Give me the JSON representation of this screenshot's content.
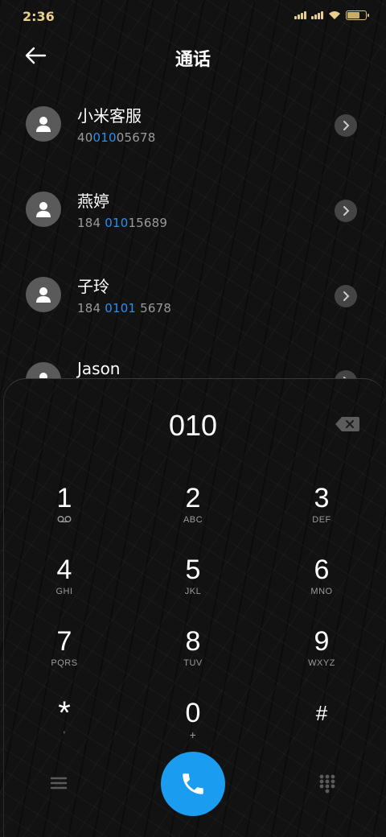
{
  "status": {
    "time": "2:36"
  },
  "header": {
    "title": "通话"
  },
  "contacts": [
    {
      "name": "小米客服",
      "num_pre": "40",
      "num_hl": "010",
      "num_post": "05678"
    },
    {
      "name": "燕婷",
      "num_pre": "184 ",
      "num_hl": "010",
      "num_post": "15689"
    },
    {
      "name": "子玲",
      "num_pre": "184 ",
      "num_hl": "0101",
      "num_post": " 5678"
    },
    {
      "name": "Jason",
      "num_pre": "",
      "num_hl": "",
      "num_post": ""
    }
  ],
  "dialer": {
    "number": "010",
    "keys": [
      {
        "digit": "1",
        "letters": ""
      },
      {
        "digit": "2",
        "letters": "ABC"
      },
      {
        "digit": "3",
        "letters": "DEF"
      },
      {
        "digit": "4",
        "letters": "GHI"
      },
      {
        "digit": "5",
        "letters": "JKL"
      },
      {
        "digit": "6",
        "letters": "MNO"
      },
      {
        "digit": "7",
        "letters": "PQRS"
      },
      {
        "digit": "8",
        "letters": "TUV"
      },
      {
        "digit": "9",
        "letters": "WXYZ"
      },
      {
        "digit": "*",
        "letters": ","
      },
      {
        "digit": "0",
        "letters": "+"
      },
      {
        "digit": "#",
        "letters": ""
      }
    ]
  },
  "icons": {
    "back": "arrow-left-icon",
    "avatar": "person-icon",
    "detail": "chevron-right-icon",
    "delete": "backspace-icon",
    "voicemail": "voicemail-icon",
    "menu": "menu-icon",
    "call": "phone-icon",
    "dialpad": "dialpad-icon"
  },
  "colors": {
    "accent": "#1a9cf0",
    "highlight": "#2a8ef0",
    "status": "#e8cf8c"
  }
}
